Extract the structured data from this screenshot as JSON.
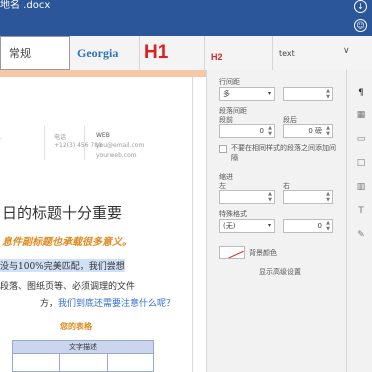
{
  "window": {
    "title": "地名 .docx"
  },
  "ribbon": {
    "styles": [
      {
        "name": "normal",
        "label": "常规"
      },
      {
        "name": "georgia",
        "label": "Georgia"
      },
      {
        "name": "h1",
        "label": "H1"
      },
      {
        "name": "h2",
        "label": "H2"
      },
      {
        "name": "text",
        "label": "text"
      }
    ]
  },
  "document": {
    "contact": {
      "phone_label": "电话",
      "phone_value": "+12(3) 456 789",
      "web_label": "WEB",
      "web_line1": "you@email.com",
      "web_line2": "yourweb.com"
    },
    "heading": "日的标题十分重要",
    "subtitle": "息件副标题也承载很多意义。",
    "para1": "没与100%完美匹配，我们尝想",
    "para2": "段落、图纸页等、必须调理的文件",
    "para3_plain": "方，",
    "para3_link": "我们到底还需要注意什么呢？",
    "caption": "您的表格",
    "table_header": "文字描述"
  },
  "panel": {
    "line_spacing_label": "行间距",
    "line_spacing_value": "多",
    "paragraph_spacing_label": "段落间距",
    "before_label": "段前",
    "after_label": "段后",
    "before_value": "0",
    "after_value": "0 磅",
    "dont_add_space_label": "不要在相同样式的段落之间添加间隔",
    "indent_label": "缩进",
    "left_label": "左",
    "right_label": "右",
    "special_label": "特殊格式",
    "special_value": "(无)",
    "special_amount": "0",
    "bg_color_label": "背景颜色",
    "advanced_label": "显示高级设置"
  },
  "sidebar": {
    "icons": [
      "paragraph-icon",
      "table-icon",
      "image-icon",
      "shape-icon",
      "chart-icon",
      "text-art-icon",
      "signature-icon"
    ]
  }
}
